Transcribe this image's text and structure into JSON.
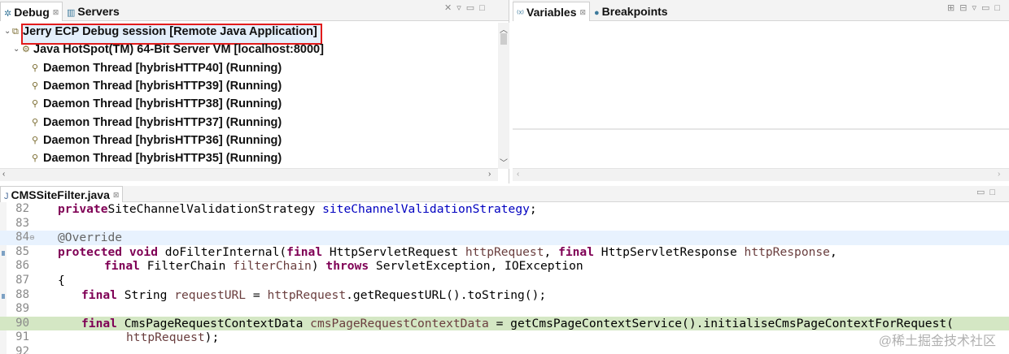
{
  "debug_view": {
    "tabs": [
      {
        "label": "Debug",
        "icon": "debug-icon"
      },
      {
        "label": "Servers",
        "icon": "servers-icon"
      }
    ],
    "tree": [
      {
        "label": "Jerry ECP Debug session [Remote Java Application]",
        "icon": "remote-launch-icon",
        "expanded": true
      },
      {
        "label": "Java HotSpot(TM) 64-Bit Server VM [localhost:8000]",
        "icon": "vm-icon",
        "expanded": true
      },
      {
        "label": "Daemon Thread [hybrisHTTP40] (Running)",
        "icon": "thread-running-icon"
      },
      {
        "label": "Daemon Thread [hybrisHTTP39] (Running)",
        "icon": "thread-running-icon"
      },
      {
        "label": "Daemon Thread [hybrisHTTP38] (Running)",
        "icon": "thread-running-icon"
      },
      {
        "label": "Daemon Thread [hybrisHTTP37] (Running)",
        "icon": "thread-running-icon"
      },
      {
        "label": "Daemon Thread [hybrisHTTP36] (Running)",
        "icon": "thread-running-icon"
      },
      {
        "label": "Daemon Thread [hybrisHTTP35] (Running)",
        "icon": "thread-running-icon"
      }
    ]
  },
  "variables_view": {
    "tabs": [
      {
        "label": "Variables",
        "icon": "variables-icon"
      },
      {
        "label": "Breakpoints",
        "icon": "breakpoints-icon"
      }
    ]
  },
  "editor": {
    "tab_label": "CMSSiteFilter.java",
    "lines": [
      {
        "num": "82",
        "indent": 1,
        "tokens": [
          [
            "kw",
            "private"
          ],
          [
            "",
            "SiteChannelValidationStrategy "
          ],
          [
            "fld",
            "siteChannelValidationStrategy"
          ],
          [
            "",
            ";"
          ]
        ]
      },
      {
        "num": "83",
        "indent": 1,
        "tokens": []
      },
      {
        "num": "84",
        "indent": 1,
        "fold": true,
        "hl": "current",
        "tokens": [
          [
            "ann",
            "@Override"
          ]
        ]
      },
      {
        "num": "85",
        "indent": 1,
        "tokens": [
          [
            "kw",
            "protected void"
          ],
          [
            "",
            " doFilterInternal("
          ],
          [
            "kw",
            "final"
          ],
          [
            "",
            " HttpServletRequest "
          ],
          [
            "var",
            "httpRequest"
          ],
          [
            "",
            ", "
          ],
          [
            "kw",
            "final"
          ],
          [
            "",
            " HttpServletResponse "
          ],
          [
            "var",
            "httpResponse"
          ],
          [
            "",
            ","
          ]
        ]
      },
      {
        "num": "86",
        "indent": 2,
        "tokens": [
          [
            "kw",
            "final"
          ],
          [
            "",
            " FilterChain "
          ],
          [
            "var",
            "filterChain"
          ],
          [
            "",
            ") "
          ],
          [
            "kw",
            "throws"
          ],
          [
            "",
            " ServletException, IOException"
          ]
        ]
      },
      {
        "num": "87",
        "indent": 1,
        "tokens": [
          [
            "",
            "{"
          ]
        ]
      },
      {
        "num": "88",
        "indent": 3,
        "tokens": [
          [
            "kw",
            "final"
          ],
          [
            "",
            " String "
          ],
          [
            "var",
            "requestURL"
          ],
          [
            "",
            " = "
          ],
          [
            "var",
            "httpRequest"
          ],
          [
            "",
            ".getRequestURL().toString();"
          ]
        ]
      },
      {
        "num": "89",
        "indent": 1,
        "tokens": []
      },
      {
        "num": "90",
        "indent": 3,
        "hl": "breakpoint",
        "tokens": [
          [
            "kw",
            "final"
          ],
          [
            "",
            " CmsPageRequestContextData "
          ],
          [
            "var",
            "cmsPageRequestContextData"
          ],
          [
            "",
            " = getCmsPageContextService().initialiseCmsPageContextForRequest("
          ]
        ]
      },
      {
        "num": "91",
        "indent": 4,
        "tokens": [
          [
            "var",
            "httpRequest"
          ],
          [
            "",
            ");"
          ]
        ]
      },
      {
        "num": "92",
        "indent": 1,
        "tokens": []
      }
    ]
  },
  "watermark": "@稀土掘金技术社区",
  "colors": {
    "current_line": "#e8f2fe",
    "breakpoint_line": "#d4e7c4",
    "session_highlight_border": "#e21b1b",
    "keyword": "#7f0055",
    "field": "#0000c0",
    "local_var": "#6a3e3e"
  }
}
